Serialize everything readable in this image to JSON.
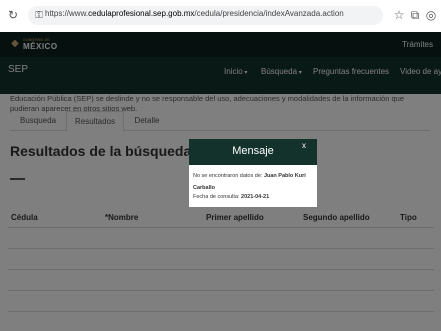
{
  "browser": {
    "url_prefix": "https://www.",
    "url_domain": "cedulaprofesional.sep.gob.mx",
    "url_path": "/cedula/presidencia/indexAvanzada.action"
  },
  "gob_header": {
    "logo_small": "GOBIERNO DE",
    "logo_text": "MÉXICO",
    "tramites": "Trámites"
  },
  "nav": {
    "brand": "SEP",
    "items": [
      "Inicio",
      "Búsqueda",
      "Preguntas frecuentes",
      "Video de ay"
    ]
  },
  "disclaimer": "Educación Pública (SEP) se deslinde y no se responsable del uso, adecuaciones y modalidades de la información que pudieran aparecer en otros sitios web.",
  "tabs": [
    "Busqueda",
    "Resultados",
    "Detalle"
  ],
  "results_title": "Resultados de la búsqueda",
  "table": {
    "headers": [
      "Cédula",
      "*Nombre",
      "Primer apellido",
      "Segundo apellido",
      "Tipo"
    ]
  },
  "modal": {
    "title": "Mensaje",
    "close": "x",
    "message_prefix": "No se encontraron datos de:",
    "name": "Juan Pablo Kuri Carballo",
    "date_label": "Fecha de consulta:",
    "date_value": "2021-04-21"
  }
}
